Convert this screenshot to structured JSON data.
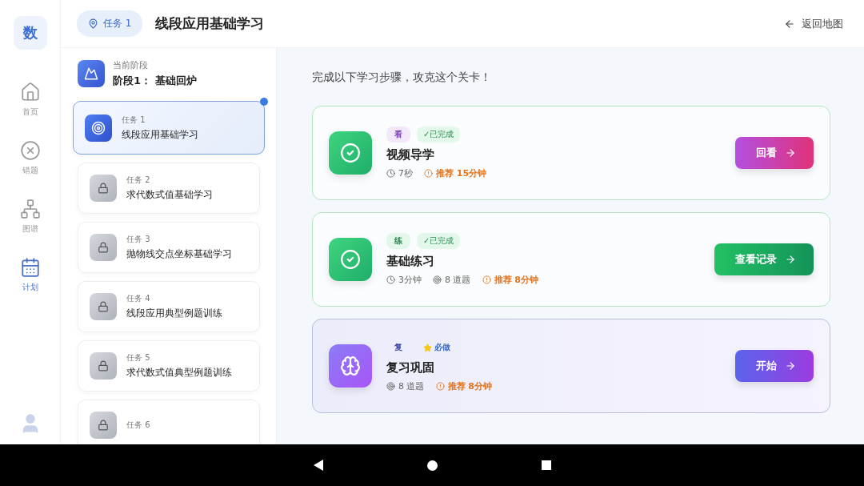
{
  "app_logo": "数",
  "nav": [
    {
      "kind": "home",
      "label": "首页",
      "selected": false
    },
    {
      "kind": "wrong",
      "label": "错题",
      "selected": false
    },
    {
      "kind": "graph",
      "label": "图谱",
      "selected": false
    },
    {
      "kind": "plan",
      "label": "计划",
      "selected": true
    }
  ],
  "header": {
    "task_badge": "任务 1",
    "title": "线段应用基础学习",
    "back": "返回地图"
  },
  "stage": {
    "caption": "当前阶段",
    "name": "阶段1： 基础回炉"
  },
  "tasks": [
    {
      "label": "任务 1",
      "title": "线段应用基础学习",
      "selected": true,
      "locked": false
    },
    {
      "label": "任务 2",
      "title": "求代数式值基础学习",
      "selected": false,
      "locked": true
    },
    {
      "label": "任务 3",
      "title": "抛物线交点坐标基础学习",
      "selected": false,
      "locked": true
    },
    {
      "label": "任务 4",
      "title": "线段应用典型例题训练",
      "selected": false,
      "locked": true
    },
    {
      "label": "任务 5",
      "title": "求代数式值典型例题训练",
      "selected": false,
      "locked": true
    },
    {
      "label": "任务 6",
      "selected": false,
      "locked": true
    }
  ],
  "intro": "完成以下学习步骤，攻克这个关卡！",
  "steps": [
    {
      "kind": "video",
      "tag": "看",
      "status": {
        "kind": "done",
        "text": "✓已完成"
      },
      "title": "视频导学",
      "meta": [
        {
          "kind": "time",
          "text": "7秒"
        },
        {
          "kind": "recommend",
          "text": "推荐 15分钟"
        }
      ],
      "button": "回看"
    },
    {
      "kind": "practice",
      "tag": "练",
      "status": {
        "kind": "done",
        "text": "✓已完成"
      },
      "title": "基础练习",
      "meta": [
        {
          "kind": "time",
          "text": "3分钟"
        },
        {
          "kind": "count",
          "text": "8 道题"
        },
        {
          "kind": "recommend",
          "text": "推荐 8分钟"
        }
      ],
      "button": "查看记录"
    },
    {
      "kind": "review",
      "tag": "复",
      "status": {
        "kind": "required",
        "text": "必做"
      },
      "title": "复习巩固",
      "meta": [
        {
          "kind": "count",
          "text": "8 道题"
        },
        {
          "kind": "recommend",
          "text": "推荐 8分钟"
        }
      ],
      "button": "开始"
    }
  ]
}
